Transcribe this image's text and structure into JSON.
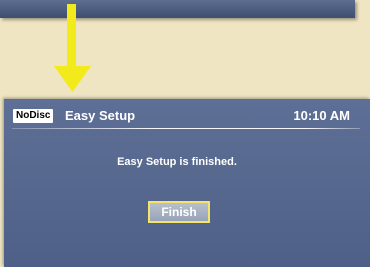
{
  "status": {
    "disc_label": "NoDisc",
    "title": "Easy Setup",
    "time": "10:10 AM"
  },
  "dialog": {
    "message": "Easy Setup is finished.",
    "finish_label": "Finish"
  },
  "colors": {
    "arrow": "#f3ea1c",
    "screen_bg": "#57688f",
    "button_border": "#f4e46a"
  }
}
